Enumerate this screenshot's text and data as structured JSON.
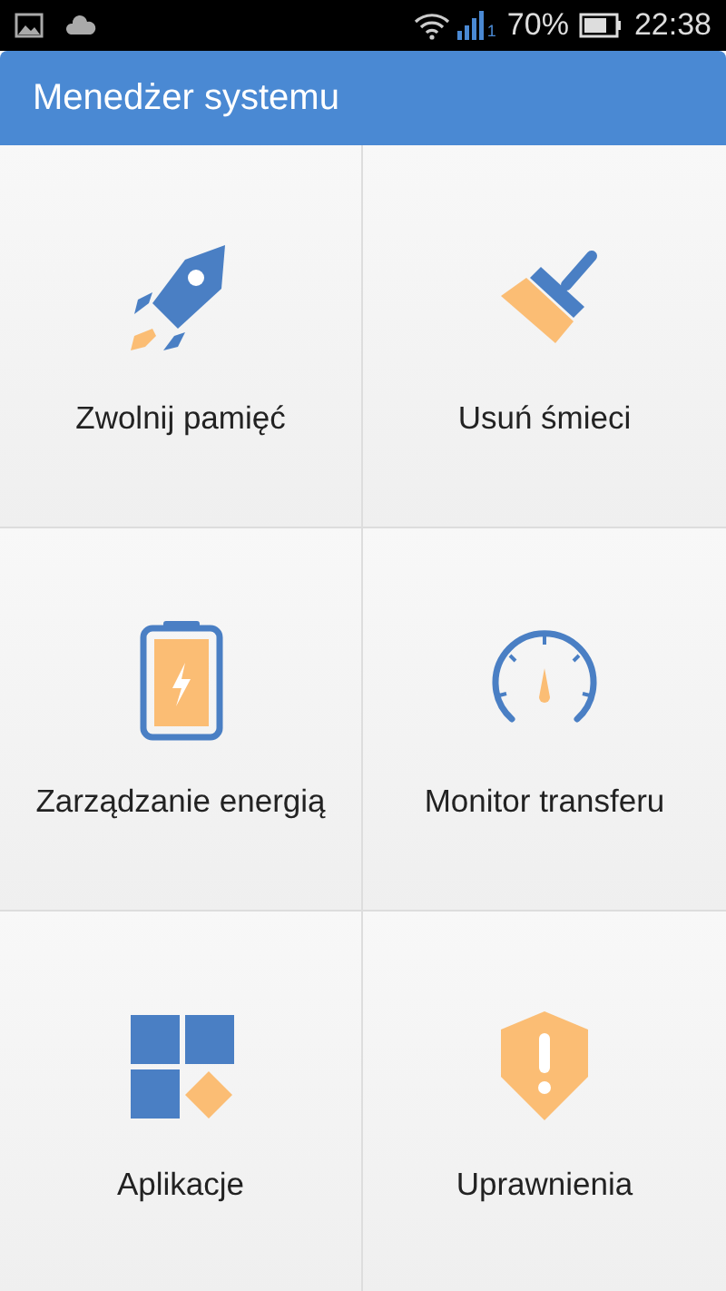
{
  "status_bar": {
    "sim_label": "1",
    "battery": "70%",
    "time": "22:38"
  },
  "app_bar": {
    "title": "Menedżer systemu"
  },
  "tiles": [
    {
      "kind": "rocket",
      "label": "Zwolnij pamięć"
    },
    {
      "kind": "broom",
      "label": "Usuń śmieci"
    },
    {
      "kind": "battery",
      "label": "Zarządzanie energią"
    },
    {
      "kind": "gauge",
      "label": "Monitor transferu"
    },
    {
      "kind": "apps",
      "label": "Aplikacje"
    },
    {
      "kind": "shield",
      "label": "Uprawnienia"
    }
  ]
}
